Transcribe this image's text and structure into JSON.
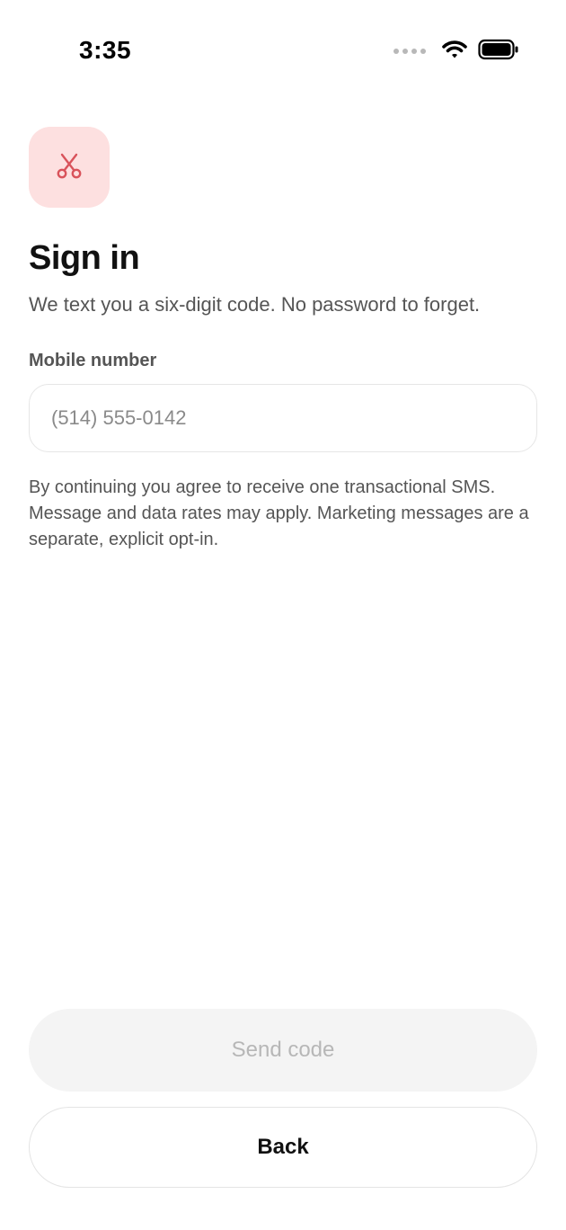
{
  "status_bar": {
    "time": "3:35"
  },
  "app_icon": {
    "icon": "scissors-icon",
    "tile_color": "#fde0e0",
    "icon_color": "#d9535b"
  },
  "header": {
    "title": "Sign in",
    "subtitle": "We text you a six-digit code. No password to forget."
  },
  "form": {
    "phone_label": "Mobile number",
    "phone_value": "",
    "phone_placeholder": "(514) 555-0142",
    "disclaimer": "By continuing you agree to receive one transactional SMS. Message and data rates may apply. Marketing messages are a separate, explicit opt-in."
  },
  "actions": {
    "send_label": "Send code",
    "send_disabled": true,
    "back_label": "Back"
  }
}
